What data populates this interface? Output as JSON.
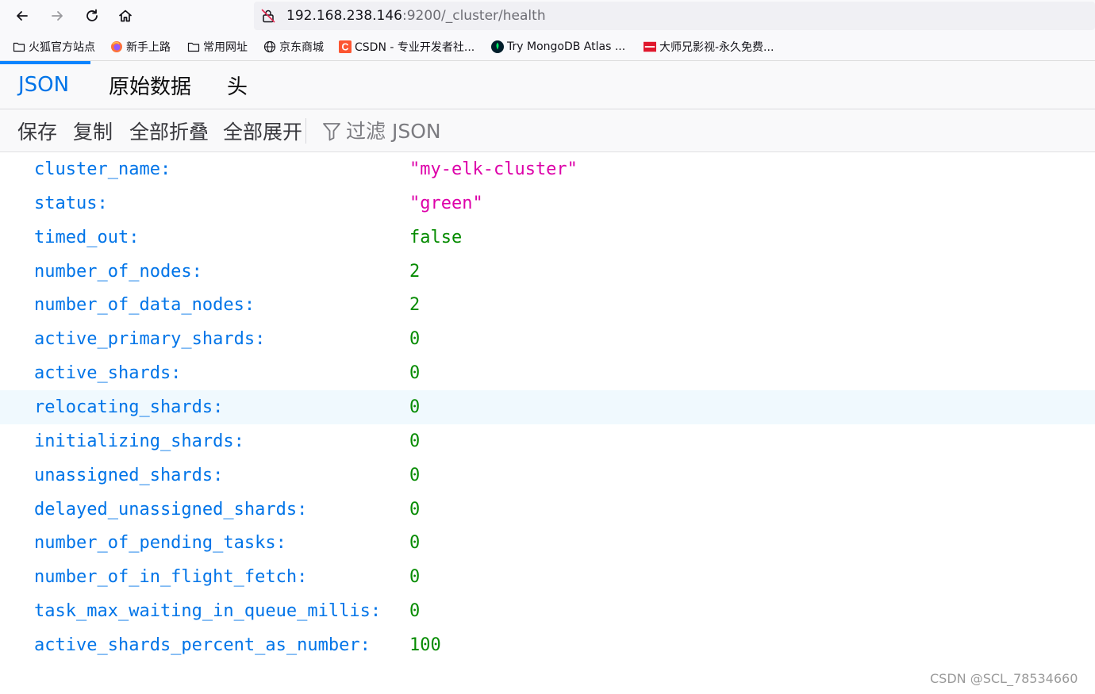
{
  "browser": {
    "url_host": "192.168.238.146",
    "url_path": ":9200/_cluster/health"
  },
  "bookmarks": [
    {
      "label": "火狐官方站点",
      "icon": "folder-icon"
    },
    {
      "label": "新手上路",
      "icon": "firefox-icon"
    },
    {
      "label": "常用网址",
      "icon": "folder-icon"
    },
    {
      "label": "京东商城",
      "icon": "globe-icon"
    },
    {
      "label": "CSDN - 专业开发者社...",
      "icon": "csdn-icon"
    },
    {
      "label": "Try MongoDB Atlas ...",
      "icon": "mongodb-icon"
    },
    {
      "label": "大师兄影视-永久免费...",
      "icon": "site-logo-icon"
    }
  ],
  "tabs": {
    "json": "JSON",
    "raw": "原始数据",
    "headers": "头"
  },
  "toolbar": {
    "save": "保存",
    "copy": "复制",
    "collapse_all": "全部折叠",
    "expand_all": "全部展开",
    "filter_placeholder": "过滤 JSON"
  },
  "json": {
    "rows": [
      {
        "key": "cluster_name:",
        "value": "\"my-elk-cluster\"",
        "type": "string"
      },
      {
        "key": "status:",
        "value": "\"green\"",
        "type": "string"
      },
      {
        "key": "timed_out:",
        "value": "false",
        "type": "bool"
      },
      {
        "key": "number_of_nodes:",
        "value": "2",
        "type": "number"
      },
      {
        "key": "number_of_data_nodes:",
        "value": "2",
        "type": "number"
      },
      {
        "key": "active_primary_shards:",
        "value": "0",
        "type": "number"
      },
      {
        "key": "active_shards:",
        "value": "0",
        "type": "number"
      },
      {
        "key": "relocating_shards:",
        "value": "0",
        "type": "number"
      },
      {
        "key": "initializing_shards:",
        "value": "0",
        "type": "number"
      },
      {
        "key": "unassigned_shards:",
        "value": "0",
        "type": "number"
      },
      {
        "key": "delayed_unassigned_shards:",
        "value": "0",
        "type": "number"
      },
      {
        "key": "number_of_pending_tasks:",
        "value": "0",
        "type": "number"
      },
      {
        "key": "number_of_in_flight_fetch:",
        "value": "0",
        "type": "number"
      },
      {
        "key": "task_max_waiting_in_queue_millis:",
        "value": "0",
        "type": "number"
      },
      {
        "key": "active_shards_percent_as_number:",
        "value": "100",
        "type": "number"
      }
    ]
  },
  "watermark": "CSDN @SCL_78534660",
  "colors": {
    "key": "#0074e8",
    "string": "#dd00a9",
    "number": "#058b00",
    "active_tab": "#0074e8",
    "hover_row": "#f0f9fe"
  }
}
